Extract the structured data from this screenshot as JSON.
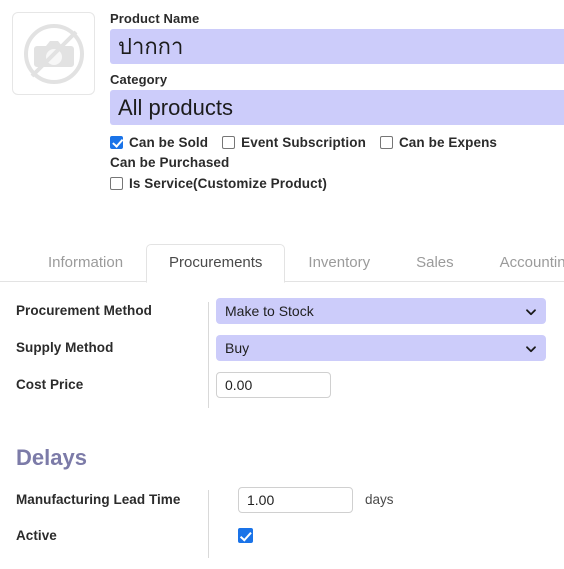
{
  "product": {
    "image_placeholder_icon": "no-camera-icon",
    "name_label": "Product Name",
    "name_value": "ปากกา",
    "category_label": "Category",
    "category_value": "All products",
    "checkboxes": [
      {
        "label": "Can be Sold",
        "checked": true
      },
      {
        "label": "Event Subscription",
        "checked": false
      },
      {
        "label": "Can be Expens",
        "checked": false
      }
    ],
    "can_be_purchased_label": "Can be Purchased",
    "is_service": {
      "label": "Is Service(Customize Product)",
      "checked": false
    }
  },
  "tabs": [
    {
      "label": "Information",
      "active": false
    },
    {
      "label": "Procurements",
      "active": true
    },
    {
      "label": "Inventory",
      "active": false
    },
    {
      "label": "Sales",
      "active": false
    },
    {
      "label": "Accounting",
      "active": false
    }
  ],
  "procurements": {
    "procurement_method": {
      "label": "Procurement Method",
      "value": "Make to Stock",
      "icon": "chevron-down-icon"
    },
    "supply_method": {
      "label": "Supply Method",
      "value": "Buy",
      "icon": "chevron-down-icon"
    },
    "cost_price": {
      "label": "Cost Price",
      "value": "0.00"
    }
  },
  "delays": {
    "title": "Delays",
    "lead_time": {
      "label": "Manufacturing Lead Time",
      "value": "1.00",
      "suffix": "days"
    },
    "active": {
      "label": "Active",
      "checked": true
    }
  },
  "colors": {
    "field_lavender": "#ccccfa",
    "checkbox_blue": "#1a73e8",
    "section_heading": "#7c7ba8",
    "label_text": "#2b2b2b",
    "tab_inactive": "#9b9b9b",
    "tab_active": "#4a4a4a",
    "border_gray": "#e3e3e3"
  }
}
